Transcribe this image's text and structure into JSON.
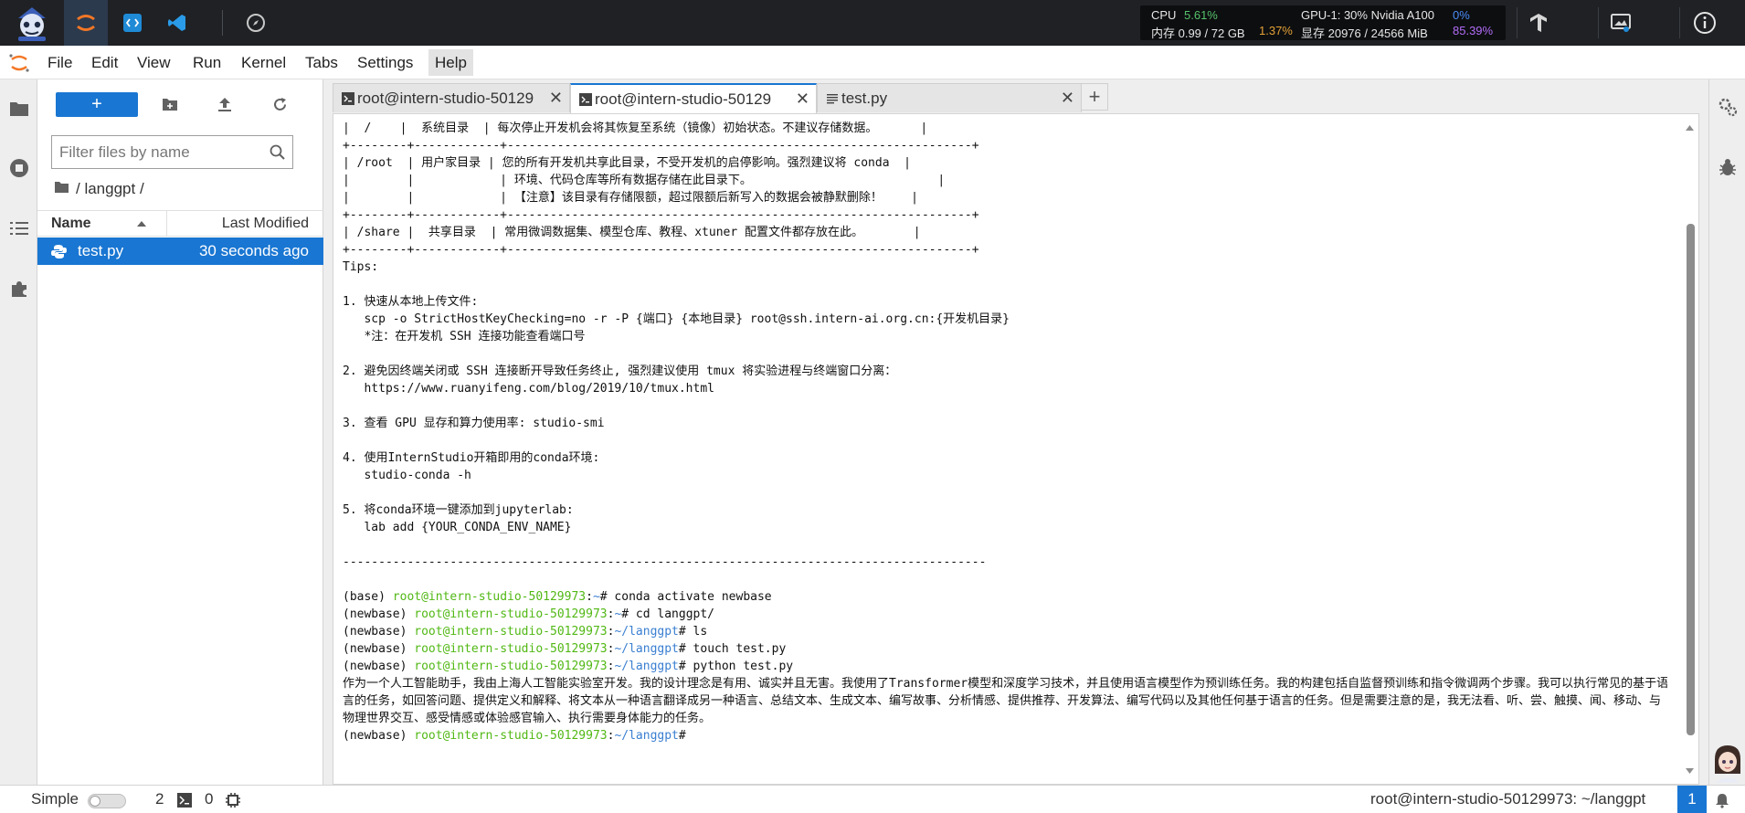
{
  "topbar": {
    "monitor": {
      "cpu_label": "CPU",
      "cpu_value": "5.61%",
      "mem_label": "内存 0.99 / 72 GB",
      "mem_value": "1.37%",
      "gpu_label": "GPU-1: 30% Nvidia A100",
      "gpu_value": "0%",
      "vram_label": "显存 20976 / 24566 MiB",
      "vram_value": "85.39%"
    },
    "colors": {
      "bar": "#1f2125",
      "accent": "#1976d2",
      "ok": "#56c26b",
      "warn": "#e3a136",
      "gpu": "#4a8cf7",
      "vram": "#b06cf5"
    },
    "icons": [
      "intern-robot-logo",
      "jupyter-icon",
      "code-server-icon",
      "vscode-icon",
      "compass-icon",
      "tensorflow-icon",
      "image-monitor-icon",
      "info-icon"
    ]
  },
  "menu": {
    "items": [
      "File",
      "Edit",
      "View",
      "Run",
      "Kernel",
      "Tabs",
      "Settings",
      "Help"
    ]
  },
  "filebrowser": {
    "new_label": "+",
    "search_placeholder": "Filter files by name",
    "breadcrumb": "/ langgpt /",
    "col_name": "Name",
    "col_modified": "Last Modified",
    "files": [
      {
        "name": "test.py",
        "modified": "30 seconds ago"
      }
    ]
  },
  "tabs": [
    {
      "label": "root@intern-studio-50129",
      "type": "terminal"
    },
    {
      "label": "root@intern-studio-50129",
      "type": "terminal"
    },
    {
      "label": "test.py",
      "type": "file"
    }
  ],
  "terminal": {
    "banner": [
      "|  /    |  系统目录  | 每次停止开发机会将其恢复至系统（镜像）初始状态。不建议存储数据。      |",
      "+--------+------------+-----------------------------------------------------------------+",
      "| /root  | 用户家目录 | 您的所有开发机共享此目录，不受开发机的启停影响。强烈建议将 conda  |",
      "|        |            | 环境、代码仓库等所有数据存储在此目录下。                          |",
      "|        |            | 【注意】该目录有存储限额，超过限额后新写入的数据会被静默删除！    |",
      "+--------+------------+-----------------------------------------------------------------+",
      "| /share |  共享目录  | 常用微调数据集、模型仓库、教程、xtuner 配置文件都存放在此。       |",
      "+--------+------------+-----------------------------------------------------------------+",
      "Tips:",
      "",
      "1. 快速从本地上传文件:",
      "   scp -o StrictHostKeyChecking=no -r -P {端口} {本地目录} root@ssh.intern-ai.org.cn:{开发机目录}",
      "   *注：在开发机 SSH 连接功能查看端口号",
      "",
      "2. 避免因终端关闭或 SSH 连接断开导致任务终止, 强烈建议使用 tmux 将实验进程与终端窗口分离：",
      "   https://www.ruanyifeng.com/blog/2019/10/tmux.html",
      "",
      "3. 查看 GPU 显存和算力使用率: studio-smi",
      "",
      "4. 使用InternStudio开箱即用的conda环境:",
      "   studio-conda -h",
      "",
      "5. 将conda环境一键添加到jupyterlab:",
      "   lab add {YOUR_CONDA_ENV_NAME}",
      "",
      "------------------------------------------------------------------------------------------",
      ""
    ],
    "prompts": [
      {
        "env": "(base) ",
        "user": "root@intern-studio-50129973",
        "sep": ":",
        "path": "~",
        "cmd": "# conda activate newbase"
      },
      {
        "env": "(newbase) ",
        "user": "root@intern-studio-50129973",
        "sep": ":",
        "path": "~",
        "cmd": "# cd langgpt/"
      },
      {
        "env": "(newbase) ",
        "user": "root@intern-studio-50129973",
        "sep": ":",
        "path": "~/langgpt",
        "cmd": "# ls"
      },
      {
        "env": "(newbase) ",
        "user": "root@intern-studio-50129973",
        "sep": ":",
        "path": "~/langgpt",
        "cmd": "# touch test.py"
      },
      {
        "env": "(newbase) ",
        "user": "root@intern-studio-50129973",
        "sep": ":",
        "path": "~/langgpt",
        "cmd": "# python test.py"
      }
    ],
    "output": "作为一个人工智能助手，我由上海人工智能实验室开发。我的设计理念是有用、诚实并且无害。我使用了Transformer模型和深度学习技术，并且使用语言模型作为预训练任务。我的构建包括自监督预训练和指令微调两个步骤。我可以执行常见的基于语言的任务，如回答问题、提供定义和解释、将文本从一种语言翻译成另一种语言、总结文本、生成文本、编写故事、分析情感、提供推荐、开发算法、编写代码以及其他任何基于语言的任务。但是需要注意的是，我无法看、听、尝、触摸、闻、移动、与物理世界交互、感受情感或体验感官输入、执行需要身体能力的任务。",
    "final_prompt": {
      "env": "(newbase) ",
      "user": "root@intern-studio-50129973",
      "sep": ":",
      "path": "~/langgpt",
      "cmd": "#"
    }
  },
  "statusbar": {
    "mode_label": "Simple",
    "terminals_count": "2",
    "kernels_count": "0",
    "location": "root@intern-studio-50129973: ~/langgpt",
    "badge": "1"
  }
}
